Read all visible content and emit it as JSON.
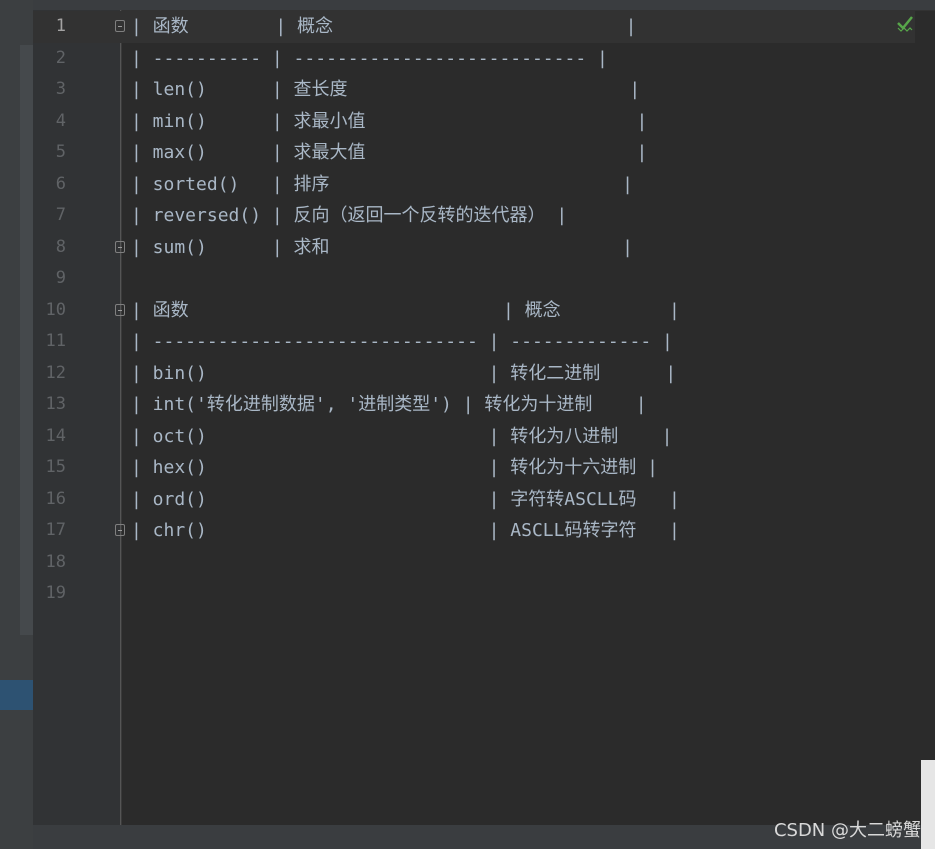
{
  "watermark": "CSDN @大二螃蟹",
  "icons": {
    "status": "check-icon",
    "fold": "fold-marker-icon"
  },
  "editor": {
    "lines": [
      {
        "n": "1",
        "text": "| 函数        | 概念                           |",
        "current": true,
        "fold": true
      },
      {
        "n": "2",
        "text": "| ---------- | --------------------------- |"
      },
      {
        "n": "3",
        "text": "| len()      | 查长度                          |"
      },
      {
        "n": "4",
        "text": "| min()      | 求最小值                         |"
      },
      {
        "n": "5",
        "text": "| max()      | 求最大值                         |"
      },
      {
        "n": "6",
        "text": "| sorted()   | 排序                           |"
      },
      {
        "n": "7",
        "text": "| reversed() | 反向（返回一个反转的迭代器） |"
      },
      {
        "n": "8",
        "text": "| sum()      | 求和                           |",
        "fold": true
      },
      {
        "n": "9",
        "text": ""
      },
      {
        "n": "10",
        "text": "| 函数                             | 概念          |",
        "fold": true
      },
      {
        "n": "11",
        "text": "| ------------------------------ | ------------- |"
      },
      {
        "n": "12",
        "text": "| bin()                          | 转化二进制      |"
      },
      {
        "n": "13",
        "text": "| int('转化进制数据', '进制类型') | 转化为十进制    |"
      },
      {
        "n": "14",
        "text": "| oct()                          | 转化为八进制    |"
      },
      {
        "n": "15",
        "text": "| hex()                          | 转化为十六进制 |"
      },
      {
        "n": "16",
        "text": "| ord()                          | 字符转ASCLL码   |"
      },
      {
        "n": "17",
        "text": "| chr()                          | ASCLL码转字符   |",
        "fold": true
      },
      {
        "n": "18",
        "text": ""
      },
      {
        "n": "19",
        "text": ""
      }
    ]
  }
}
